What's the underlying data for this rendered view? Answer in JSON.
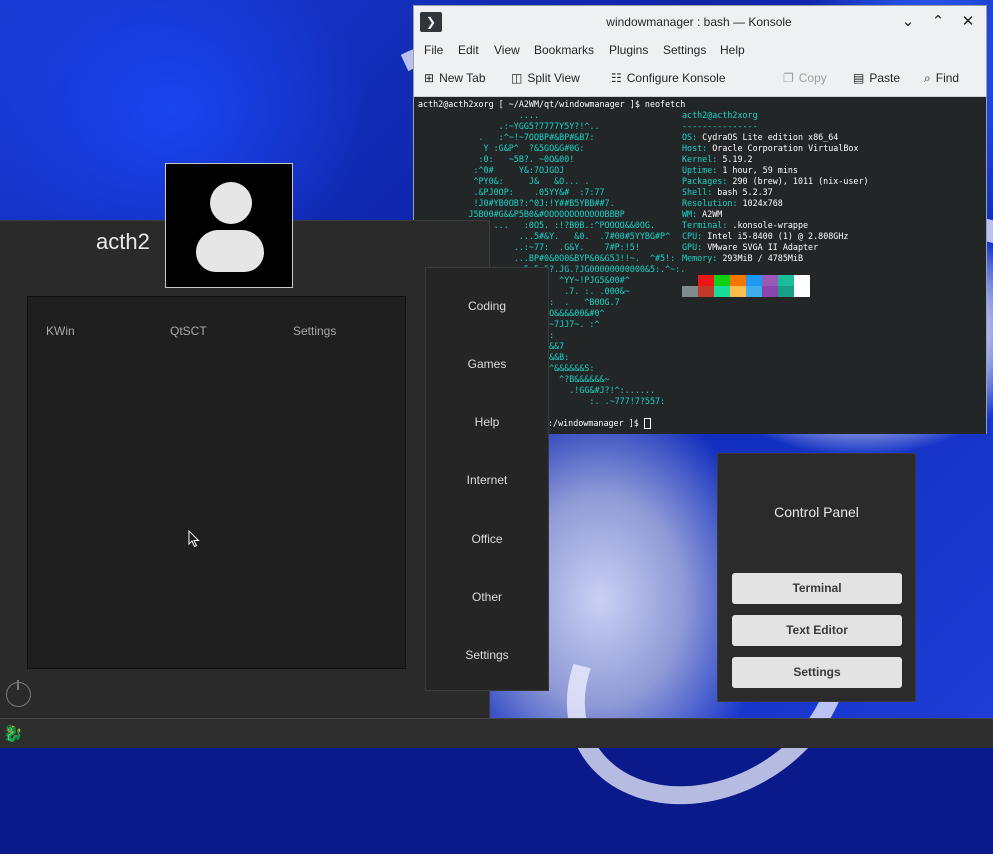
{
  "konsole": {
    "title": "windowmanager : bash — Konsole",
    "menu": [
      "File",
      "Edit",
      "View",
      "Bookmarks",
      "Plugins",
      "Settings",
      "Help"
    ],
    "toolbar": {
      "new_tab": "New Tab",
      "split_view": "Split View",
      "configure": "Configure Konsole",
      "copy": "Copy",
      "paste": "Paste",
      "find": "Find"
    },
    "prompt_line": "acth2@acth2xorg [ ~/A2WM/qt/windowmanager ]$ neofetch",
    "ascii_art": "                    ....\n                .:~YGG5?7777Y5Y?!^..\n            .   :^~!~7OOBP#&BP#&B7:\n             Y :G&P^  ?&5GO&G#0G:\n            :0:   ~5B?. ~0O&00!\n           :^0#     Y&:7OJGOJ\n           ^PY0&:     J&   &O... .\n           .&PJ0OP:    .05YY&#  :7:77\n           !J0#YB0OB?:^0J:!Y##B5YBB##7.\n          J5B00#G&&P5B0&#OOOOOOOOOOOOBBBP\n               ...   :0O5. :!?B0B.:^POOOO&&0OG.\n                    ...5#&Y.   &0.  .7#00#5YYBG#P^\n                   ..:~77:  .G&Y.    7#P:!5!\n                   ...BP#0&0O0&BYP&0&G5J!!~.  ^#5!:\n                   .:5.5.5?.JG.?JG00000000000&5:.^~:.\n                            ^YY~!PJG5&00#^\n                             .7. :. .000&~\n                         7:  .   ^B0OG.7\n                        00O&&&&00&#0^\n                        !~~7JJ7~. :^\n                        B5:\n                        0&&&7\n                        #0&&B:\n                          ^&&&&&&S:\n                            ^?B&&&&&&~\n                              .!GG&#J?!^:......\n                                  :. .~777!7?557:",
    "info": [
      {
        "label": "",
        "value": "acth2@acth2xorg"
      },
      {
        "label": "",
        "value": "---------------"
      },
      {
        "label": "OS",
        "value": "CydraOS Lite edition x86_64"
      },
      {
        "label": "Host",
        "value": "Oracle Corporation VirtualBox"
      },
      {
        "label": "Kernel",
        "value": "5.19.2"
      },
      {
        "label": "Uptime",
        "value": "1 hour, 59 mins"
      },
      {
        "label": "Packages",
        "value": "290 (brew), 1011 (nix-user)"
      },
      {
        "label": "Shell",
        "value": "bash 5.2.37"
      },
      {
        "label": "Resolution",
        "value": "1024x768"
      },
      {
        "label": "WM",
        "value": "A2WM"
      },
      {
        "label": "Terminal",
        "value": ".konsole-wrappe"
      },
      {
        "label": "CPU",
        "value": "Intel i5-8400 (1) @ 2.808GHz"
      },
      {
        "label": "GPU",
        "value": "VMware SVGA II Adapter"
      },
      {
        "label": "Memory",
        "value": "293MiB / 4785MiB"
      }
    ],
    "swatches_top": [
      "#232627",
      "#ed1515",
      "#11d116",
      "#f67400",
      "#1d99f3",
      "#9b59b6",
      "#1abc9c",
      "#fcfcfc"
    ],
    "swatches_bottom": [
      "#7f8c8d",
      "#c0392b",
      "#1cdc9a",
      "#fdbc4b",
      "#3daee9",
      "#8e44ad",
      "#16a085",
      "#ffffff"
    ],
    "prompt_end": ":/windowmanager ]$"
  },
  "launcher": {
    "username": "acth2",
    "favorites": [
      "KWin",
      "QtSCT",
      "Settings"
    ],
    "categories": [
      "Coding",
      "Games",
      "Help",
      "Internet",
      "Office",
      "Other",
      "Settings"
    ]
  },
  "control_panel": {
    "title": "Control Panel",
    "buttons": [
      "Terminal",
      "Text Editor",
      "Settings"
    ]
  }
}
